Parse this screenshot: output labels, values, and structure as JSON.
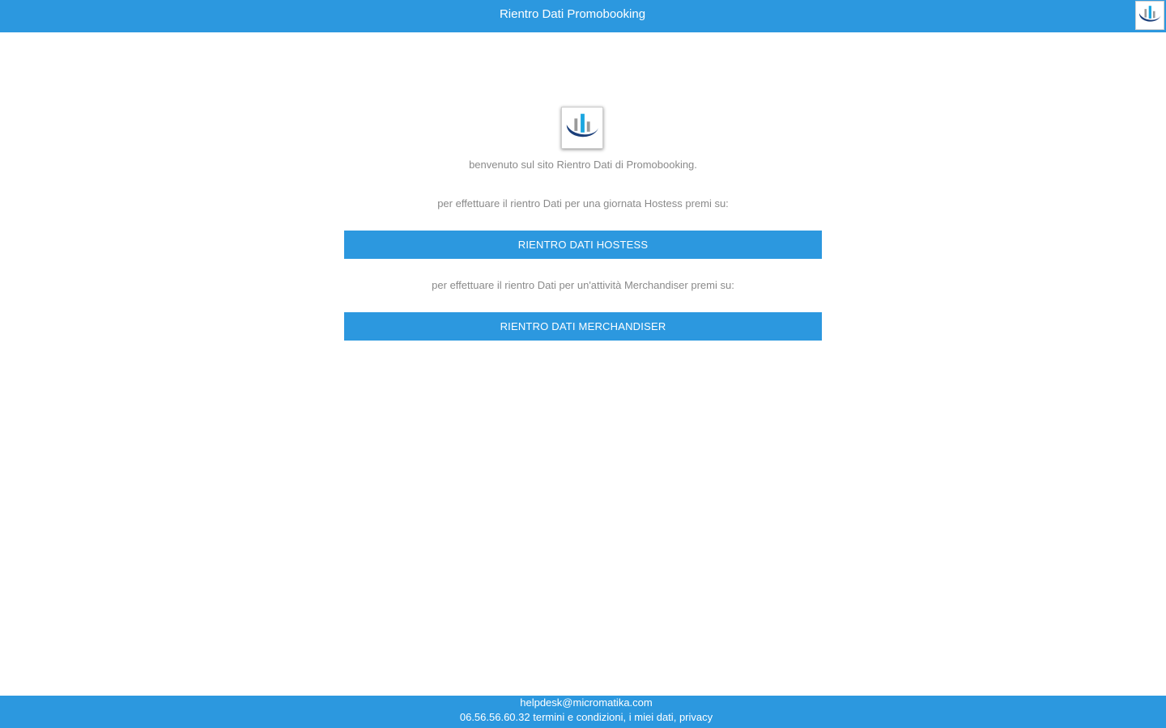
{
  "header": {
    "title": "Rientro Dati Promobooking",
    "logo_icon": "promobooking-logo-icon"
  },
  "main": {
    "logo_icon": "promobooking-logo-icon",
    "welcome_text": "benvenuto sul sito Rientro Dati di Promobooking.",
    "hostess_prompt": "per effettuare il rientro Dati per una giornata Hostess premi su:",
    "hostess_button_label": "RIENTRO DATI HOSTESS",
    "merch_prompt": "per effettuare il rientro Dati per un'attività Merchandiser premi su:",
    "merch_button_label": "RIENTRO DATI MERCHANDISER"
  },
  "footer": {
    "email": "helpdesk@micromatika.com",
    "phone": "06.56.56.60.32",
    "terms_link": "termini e condizioni",
    "separator1": ",",
    "data_link": "i miei dati",
    "separator2": ",",
    "privacy_link": "privacy"
  },
  "colors": {
    "accent": "#2c98df",
    "text_muted": "#8a8a8a",
    "logo_navy": "#1b3f7a",
    "logo_cyan": "#1aa6e0",
    "logo_gray": "#9a9a9a"
  }
}
